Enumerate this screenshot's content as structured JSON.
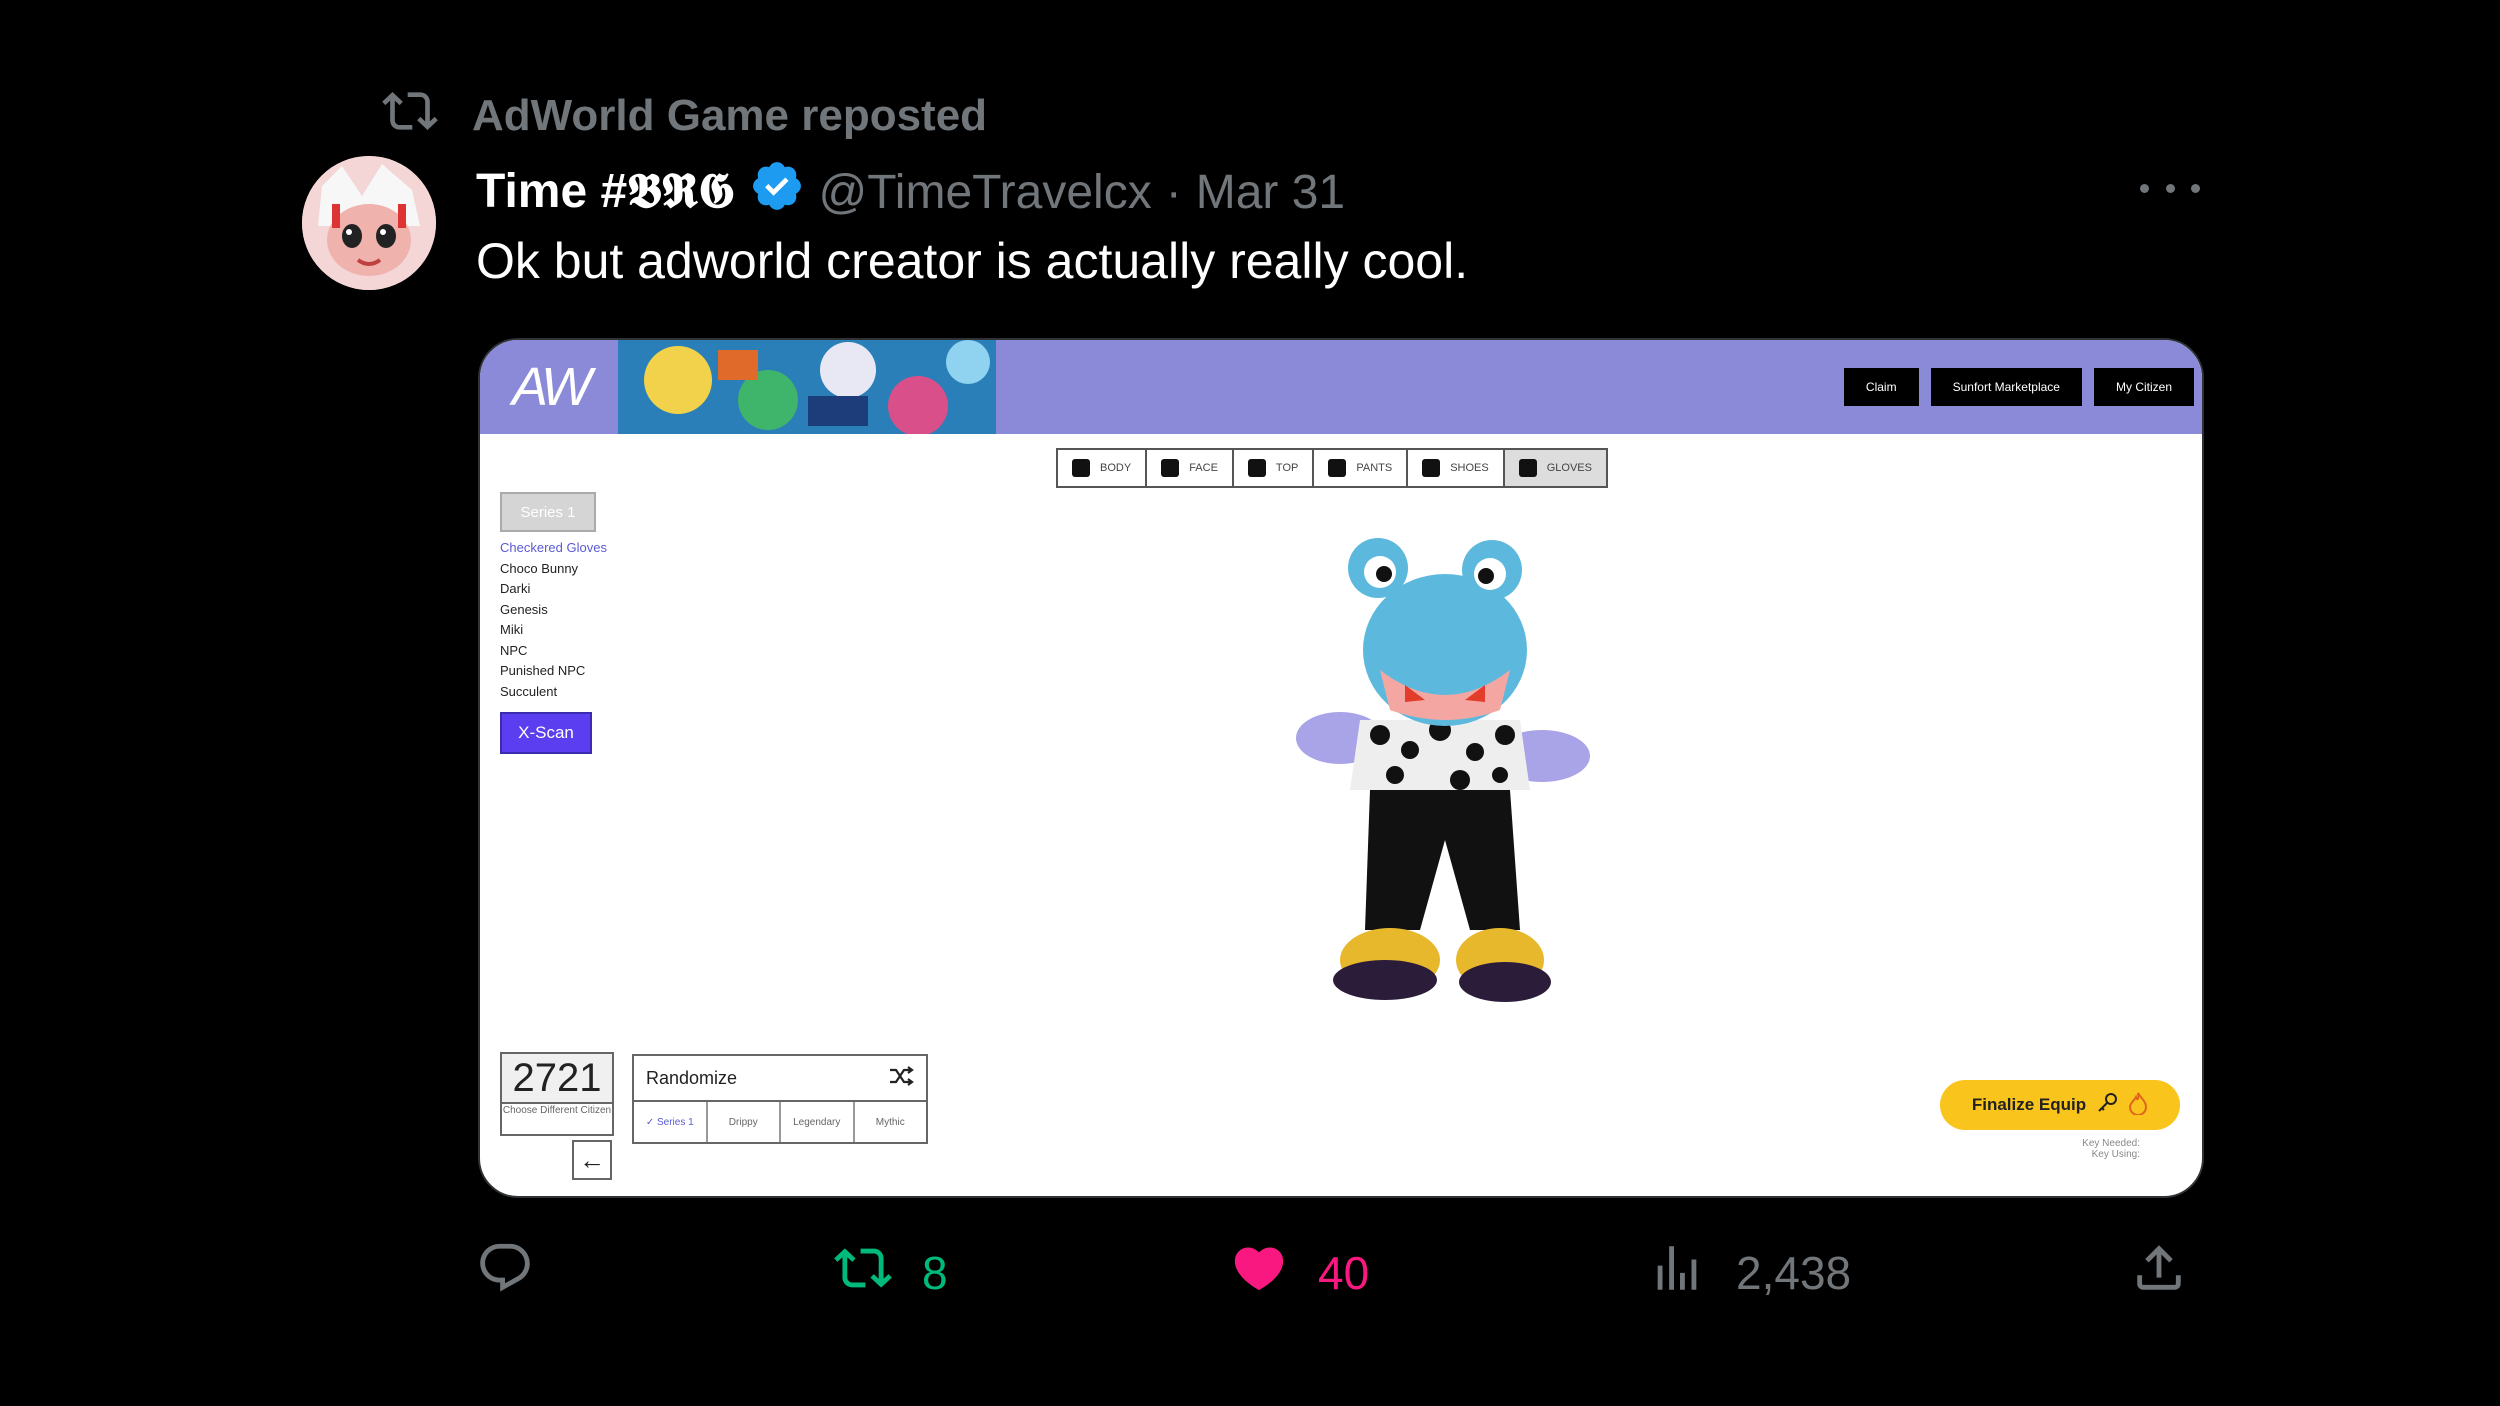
{
  "repost": {
    "label": "AdWorld Game reposted"
  },
  "tweet": {
    "author_name": "Time #𝕭𝕽𝕲",
    "handle": "@TimeTravelcx",
    "separator": "·",
    "date": "Mar 31",
    "text": "Ok but adworld creator is actually really cool."
  },
  "screenshot": {
    "logo": "AW",
    "nav": [
      "Claim",
      "Sunfort Marketplace",
      "My Citizen"
    ],
    "tabs": [
      "BODY",
      "FACE",
      "TOP",
      "PANTS",
      "SHOES",
      "GLOVES"
    ],
    "series_button": "Series 1",
    "items": [
      "Checkered Gloves",
      "Choco Bunny",
      "Darki",
      "Genesis",
      "Miki",
      "NPC",
      "Punished NPC",
      "Succulent"
    ],
    "xscan": "X-Scan",
    "citizen_number": "2721",
    "citizen_sub": "Choose Different Citizen",
    "back": "←",
    "randomize": "Randomize",
    "rand_options": [
      "✓ Series 1",
      "Drippy",
      "Legendary",
      "Mythic"
    ],
    "finalize": "Finalize Equip",
    "key_needed": "Key Needed:",
    "key_using": "Key Using:"
  },
  "actions": {
    "retweets": "8",
    "likes": "40",
    "views": "2,438"
  },
  "colors": {
    "retweet": "#00ba7c",
    "like": "#f91880",
    "muted": "#71767b",
    "verified": "#1d9bf0"
  }
}
